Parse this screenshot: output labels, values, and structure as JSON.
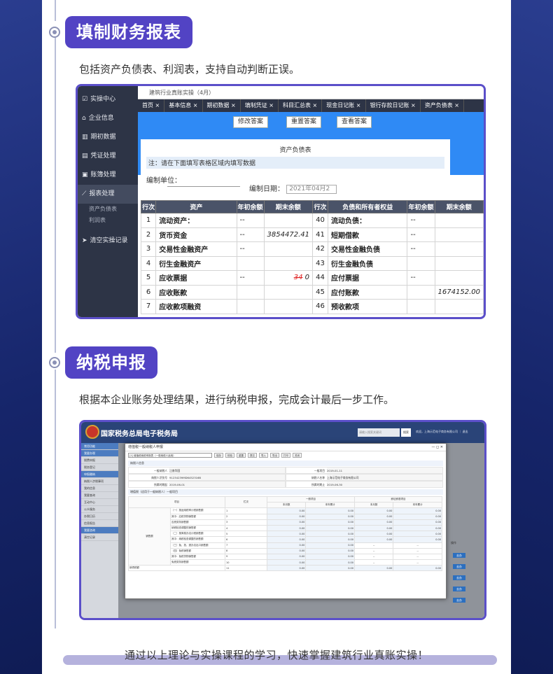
{
  "sections": [
    {
      "title": "填制财务报表",
      "description": "包括资产负债表、利润表，支持自动判断正误。"
    },
    {
      "title": "纳税申报",
      "description": "根据本企业账务处理结果，进行纳税申报，完成会计最后一步工作。"
    }
  ],
  "footer_text": "通过以上理论与实操课程的学习，快速掌握建筑行业真账实操！",
  "colors": {
    "accent": "#5243c4",
    "frame": "#5b4fc9",
    "page_bg": "#1a2a6b"
  },
  "app1": {
    "breadcrumb": "建筑行业真账实操（4月）",
    "sidebar": {
      "items": [
        {
          "label": "实操中心",
          "icon": "checkbox-icon"
        },
        {
          "label": "企业信息",
          "icon": "building-icon"
        },
        {
          "label": "期初数据",
          "icon": "bar-chart-icon"
        },
        {
          "label": "凭证处理",
          "icon": "document-icon"
        },
        {
          "label": "账簿处理",
          "icon": "book-icon"
        },
        {
          "label": "报表处理",
          "icon": "line-chart-icon"
        }
      ],
      "sub_items": [
        "资产负债表",
        "利润表"
      ],
      "clear_label": "清空实操记录"
    },
    "tabs": [
      "首页",
      "基本信息",
      "期初数据",
      "填制凭证",
      "科目汇总表",
      "现金日记账",
      "银行存款日记账",
      "资产负债表"
    ],
    "buttons": [
      "修改答案",
      "重置答案",
      "查看答案"
    ],
    "sheet": {
      "title": "资产负债表",
      "note": "注：请在下面填写表格区域内填写数据",
      "unit_label": "编制单位：",
      "date_label": "编制日期：",
      "date_value": "2021年04月2"
    },
    "table": {
      "headers": [
        "行次",
        "资产",
        "年初余额",
        "期末余额",
        "行次",
        "负债和所有者权益",
        "年初余额",
        "期末余额"
      ],
      "rows": [
        [
          "1",
          "流动资产：",
          "--",
          "",
          "40",
          "流动负债：",
          "--",
          ""
        ],
        [
          "2",
          "货币资金",
          "--",
          "3854472.41",
          "41",
          "短期借款",
          "--",
          ""
        ],
        [
          "3",
          "交易性金融资产",
          "--",
          "",
          "42",
          "交易性金融负债",
          "--",
          ""
        ],
        [
          "4",
          "衍生金融资产",
          "",
          "",
          "43",
          "衍生金融负债",
          "",
          ""
        ],
        [
          "5",
          "应收票据",
          "--",
          "34 0",
          "44",
          "应付票据",
          "--",
          ""
        ],
        [
          "6",
          "应收账款",
          "",
          "",
          "45",
          "应付账款",
          "",
          "1674152.00"
        ],
        [
          "7",
          "应收款项融资",
          "",
          "",
          "46",
          "预收款项",
          "",
          ""
        ]
      ]
    }
  },
  "app2": {
    "header_title": "国家税务总局电子税务局",
    "search_placeholder": "请输入搜索关键词",
    "search_button": "搜索",
    "header_user": "欢迎，上海示范电子商务有限公司 ｜ 退出",
    "sidebar_items": [
      "常用功能",
      "我要办税",
      "税费申报",
      "税务登记",
      "申报缴纳",
      "纳税人涉税事项",
      "我的信息",
      "我要查询",
      "互动中心",
      "公众服务",
      "办税日历",
      "信息报告",
      "我要咨询",
      "清空记录"
    ],
    "dialog": {
      "title": "增值税一般纳税人申报",
      "select_value": "[1] 增值税纳税申报表（一般纳税人适用）",
      "toolbar": [
        "保存",
        "校验",
        "重置",
        "提交",
        "导入",
        "导出",
        "打印",
        "关闭"
      ],
      "info_title": "纳税人信息",
      "info_fields": [
        {
          "label": "一般纳税人",
          "value": "江南华国"
        },
        {
          "label": "一般项目",
          "value": "2019-01-11"
        },
        {
          "label": "纳税人识别号",
          "value": "91234239MD6452316B"
        },
        {
          "label": "纳税人名称",
          "value": "上海示范电子商务有限公司"
        },
        {
          "label": "所属时期起",
          "value": "2019-06-01"
        },
        {
          "label": "所属时期止",
          "value": "2019-06-30"
        }
      ],
      "table_title": "增值税（适用于一般纳税人）一般项目",
      "col_headers": [
        "项目",
        "栏次",
        "一般项目",
        "",
        "即征即退项目",
        ""
      ],
      "sub_headers": [
        "本月数",
        "本年累计",
        "本月数",
        "本年累计"
      ],
      "group_label": "销售额",
      "rows": [
        {
          "item": "（一）按适用税率计税销售额",
          "no": "1",
          "v": [
            "0.00",
            "0.00",
            "0.00",
            "0.00"
          ]
        },
        {
          "item": "其中：应税货物销售额",
          "no": "2",
          "v": [
            "0.00",
            "0.00",
            "0.00",
            "0.00"
          ]
        },
        {
          "item": "应税劳务销售额",
          "no": "3",
          "v": [
            "0.00",
            "0.00",
            "0.00",
            "0.00"
          ]
        },
        {
          "item": "纳税检查调整的销售额",
          "no": "4",
          "v": [
            "0.00",
            "0.00",
            "0.00",
            "0.00"
          ]
        },
        {
          "item": "（二）按简易办法计税销售额",
          "no": "5",
          "v": [
            "0.00",
            "0.00",
            "0.00",
            "0.00"
          ]
        },
        {
          "item": "其中：纳税检查调整的销售额",
          "no": "6",
          "v": [
            "0.00",
            "0.00",
            "0.00",
            "0.00"
          ]
        },
        {
          "item": "（三）免、抵、退办法出口销售额",
          "no": "7",
          "v": [
            "0.00",
            "0.00",
            "--",
            "--"
          ]
        },
        {
          "item": "（四）免税销售额",
          "no": "8",
          "v": [
            "0.00",
            "0.00",
            "--",
            "--"
          ]
        },
        {
          "item": "其中：免税货物销售额",
          "no": "9",
          "v": [
            "0.00",
            "0.00",
            "--",
            "--"
          ]
        },
        {
          "item": "免税劳务销售额",
          "no": "10",
          "v": [
            "0.00",
            "0.00",
            "--",
            "--"
          ]
        },
        {
          "item": "销项税额",
          "no": "11",
          "v": [
            "0.00",
            "0.00",
            "0.00",
            "0.00"
          ]
        }
      ],
      "right_col_label": "操作",
      "right_buttons": [
        "去办",
        "去办",
        "去办",
        "去办",
        "去办"
      ]
    }
  }
}
